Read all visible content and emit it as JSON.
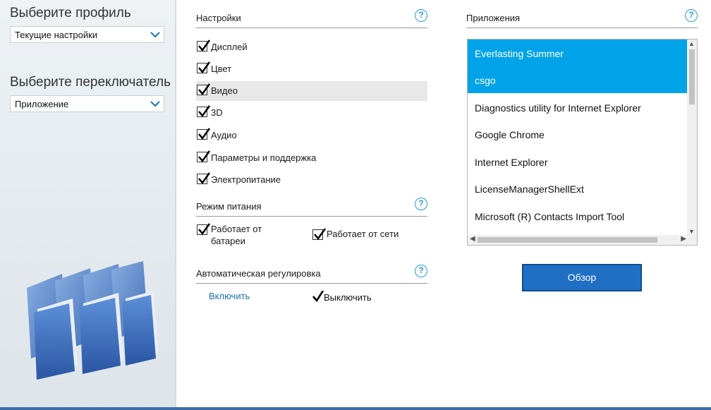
{
  "left": {
    "profile_label": "Выберите профиль",
    "profile_value": "Текущие настройки",
    "switch_label": "Выберите переключатель",
    "switch_value": "Приложение"
  },
  "settings": {
    "title": "Настройки",
    "items": [
      {
        "label": "Дисплей",
        "checked": true
      },
      {
        "label": "Цвет",
        "checked": true
      },
      {
        "label": "Видео",
        "checked": true
      },
      {
        "label": "3D",
        "checked": true
      },
      {
        "label": "Аудио",
        "checked": true
      },
      {
        "label": "Параметры и поддержка",
        "checked": true
      },
      {
        "label": "Электропитание",
        "checked": true
      }
    ]
  },
  "power": {
    "title": "Режим питания",
    "battery_line1": "Работает от",
    "battery_line2": "батареи",
    "ac": "Работает от сети"
  },
  "auto": {
    "title": "Автоматическая регулировка",
    "enable": "Включить",
    "disable": "Выключить"
  },
  "apps": {
    "title": "Приложения",
    "items": [
      "Everlasting Summer",
      "csgo",
      "Diagnostics utility for Internet Explorer",
      "Google Chrome",
      "Internet Explorer",
      "LicenseManagerShellExt",
      "Microsoft (R) Contacts Import Tool"
    ],
    "browse_label": "Обзор"
  },
  "help_glyph": "?",
  "colors": {
    "selection": "#00a2e8",
    "accent": "#1f6fc5",
    "help": "#2a9ad8",
    "link": "#1e6fb3"
  }
}
